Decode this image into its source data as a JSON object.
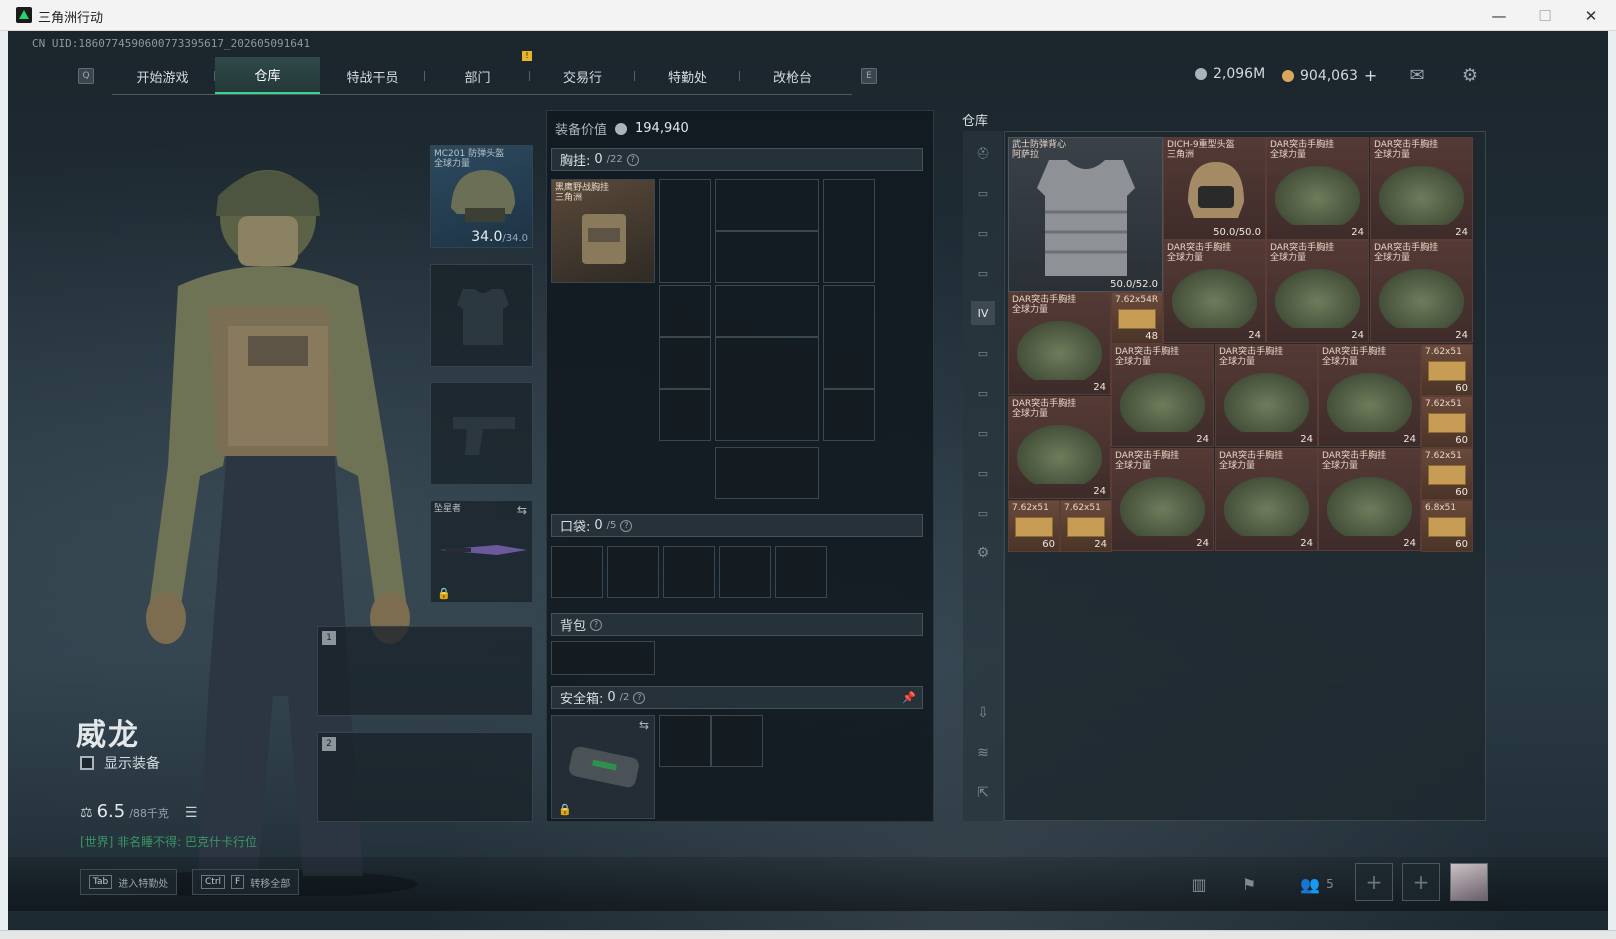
{
  "window": {
    "title": "三角洲行动",
    "minimize": "—",
    "maximize": "☐",
    "close": "✕"
  },
  "uid": "CN UID:1860774590600773395617_202605091641",
  "nav": {
    "left_key": "Q",
    "right_key": "E",
    "tabs": [
      "开始游戏",
      "仓库",
      "特战干员",
      "部门",
      "交易行",
      "特勤处",
      "改枪台"
    ],
    "active": "仓库"
  },
  "currency": {
    "a_value": "2,096M",
    "b_value": "904,063",
    "plus": "+"
  },
  "character": {
    "name": "威龙",
    "show_equipment": "显示装备",
    "weight": "6.5",
    "weight_max": "/88千克",
    "chat": "[世界] 非名睡不得: 巴克什卡行位"
  },
  "loadout": {
    "helmet": {
      "name": "MC201 防弹头盔",
      "sub": "全球力量",
      "durability": "34.0",
      "durability_max": "/34.0"
    },
    "melee": {
      "name": "坠星者"
    },
    "weapon_slots": [
      "1",
      "2"
    ]
  },
  "middle": {
    "equip_value_label": "装备价值",
    "equip_value": "194,940",
    "chest_label": "胸挂:",
    "chest_count": "0",
    "chest_max": "/22",
    "rig_name": "黑鹰野战胸挂",
    "rig_sub": "三角洲",
    "pocket_label": "口袋:",
    "pocket_count": "0",
    "pocket_max": "/5",
    "backpack_label": "背包",
    "safebox_label": "安全箱:",
    "safebox_count": "0",
    "safebox_max": "/2",
    "help": "?"
  },
  "stash": {
    "title": "仓库",
    "armor": {
      "name": "武士防弹背心",
      "sub": "阿萨拉",
      "durability": "50.0/52.0"
    },
    "helmet": {
      "name": "DICH-9重型头盔",
      "sub": "三角洲",
      "durability": "50.0/50.0"
    },
    "rig_name": "DAR突击手胸挂",
    "rig_sub": "全球力量",
    "rig_count": "24",
    "ammo_a": "7.62x54R",
    "ammo_a_count": "48",
    "ammo_b": "7.62x51",
    "ammo_b_count": "60",
    "ammo_c": "6.8x51",
    "ammo_c_count": "60",
    "ammo_d_count": "24"
  },
  "bottom": {
    "tab_key": "Tab",
    "tab_hint": "进入特勤处",
    "ctrl_key": "Ctrl",
    "f_key": "F",
    "transfer_hint": "转移全部",
    "friends": "5"
  },
  "icons": [
    "app-logo-icon",
    "mail-icon",
    "gear-icon",
    "swap-icon",
    "lock-icon",
    "pin-icon",
    "list-icon",
    "stats-icon",
    "flag-icon",
    "friends-icon",
    "avatar"
  ]
}
